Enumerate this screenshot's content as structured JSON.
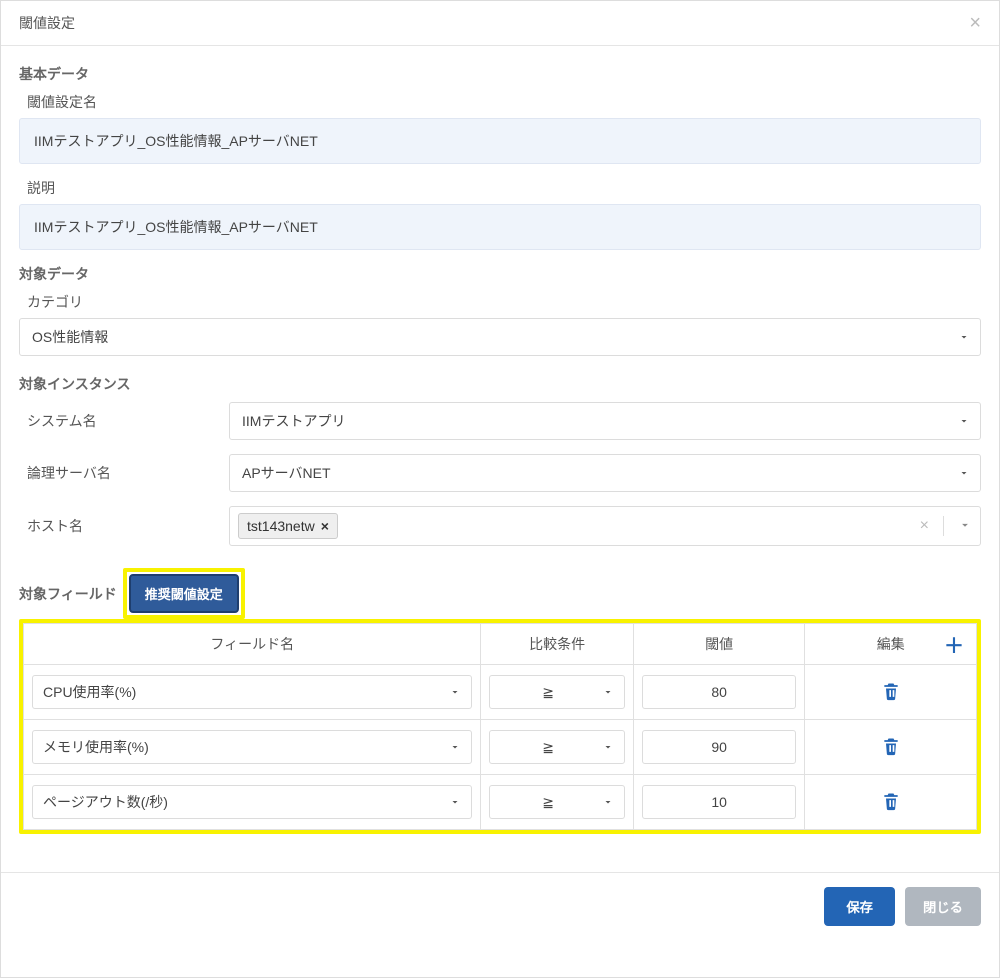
{
  "dialog": {
    "title": "閾値設定"
  },
  "basic": {
    "section": "基本データ",
    "name_label": "閾値設定名",
    "name_value": "IIMテストアプリ_OS性能情報_APサーバNET",
    "desc_label": "説明",
    "desc_value": "IIMテストアプリ_OS性能情報_APサーバNET"
  },
  "target_data": {
    "section": "対象データ",
    "category_label": "カテゴリ",
    "category_value": "OS性能情報"
  },
  "target_instance": {
    "section": "対象インスタンス",
    "system_label": "システム名",
    "system_value": "IIMテストアプリ",
    "logical_server_label": "論理サーバ名",
    "logical_server_value": "APサーバNET",
    "host_label": "ホスト名",
    "host_tag": "tst143netw"
  },
  "target_fields": {
    "section": "対象フィールド",
    "recommend_button": "推奨閾値設定",
    "columns": {
      "field": "フィールド名",
      "op": "比較条件",
      "threshold": "閾値",
      "edit": "編集"
    },
    "rows": [
      {
        "field": "CPU使用率(%)",
        "op": "≧",
        "threshold": "80"
      },
      {
        "field": "メモリ使用率(%)",
        "op": "≧",
        "threshold": "90"
      },
      {
        "field": "ページアウト数(/秒)",
        "op": "≧",
        "threshold": "10"
      }
    ]
  },
  "footer": {
    "save": "保存",
    "close": "閉じる"
  }
}
